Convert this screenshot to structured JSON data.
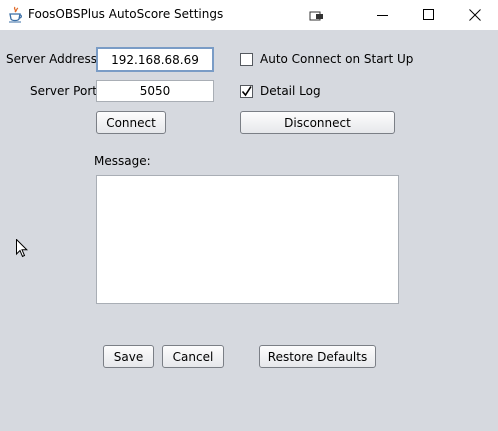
{
  "window": {
    "title": "FoosOBSPlus AutoScore Settings",
    "controls": [
      "minimize-icon",
      "maximize-icon",
      "close-icon"
    ]
  },
  "server": {
    "address_label": "Server Address",
    "address_value": "192.168.68.69",
    "port_label": "Server Port",
    "port_value": "5050"
  },
  "options": {
    "auto_connect_label": "Auto Connect on Start Up",
    "auto_connect_checked": false,
    "detail_log_label": "Detail Log",
    "detail_log_checked": true
  },
  "buttons": {
    "connect": "Connect",
    "disconnect": "Disconnect",
    "save": "Save",
    "cancel": "Cancel",
    "restore_defaults": "Restore Defaults"
  },
  "message": {
    "label": "Message:",
    "value": ""
  },
  "colors": {
    "background": "#d6d9df",
    "focus_border": "#7a9cc6"
  }
}
